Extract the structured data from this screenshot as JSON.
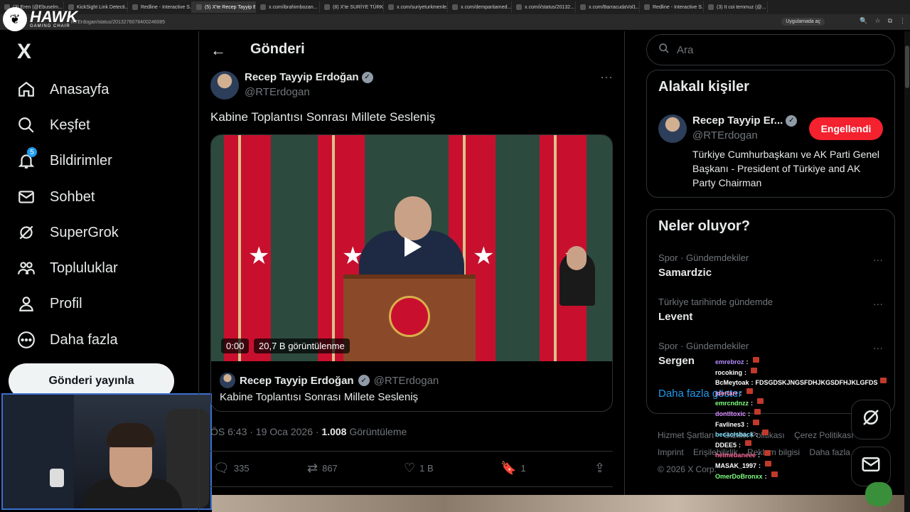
{
  "browser": {
    "tabs": [
      {
        "label": "(3) Eren (@Ebuselm...",
        "active": false
      },
      {
        "label": "KickSight Link Detecti...",
        "active": false
      },
      {
        "label": "Redline - Interactive S...",
        "active": false
      },
      {
        "label": "(5) X'te Recep Tayyip E...",
        "active": true
      },
      {
        "label": "x.com/ibrahimbozan...",
        "active": false
      },
      {
        "label": "(8) X'te SURİYE TÜRKM...",
        "active": false
      },
      {
        "label": "x.com/suriyeturkmenle...",
        "active": false
      },
      {
        "label": "x.com/dempartiamed...",
        "active": false
      },
      {
        "label": "x.com/i/status/20132...",
        "active": false
      },
      {
        "label": "x.com/BarracudaVol1...",
        "active": false
      },
      {
        "label": "Redline - Interactive S...",
        "active": false
      },
      {
        "label": "(3) It coi temmuz (@...",
        "active": false
      }
    ],
    "url": "RTErdogan/status/2013276078400246085",
    "app_pill": "Uygulamada aç"
  },
  "overlay": {
    "brand": "HAWK",
    "brand_sub": "GAMING CHAIR"
  },
  "sidebar": {
    "logo": "X",
    "items": [
      {
        "label": "Anasayfa",
        "icon": "home-icon"
      },
      {
        "label": "Keşfet",
        "icon": "search-icon"
      },
      {
        "label": "Bildirimler",
        "icon": "bell-icon",
        "badge": "5"
      },
      {
        "label": "Sohbet",
        "icon": "mail-icon"
      },
      {
        "label": "SuperGrok",
        "icon": "grok-icon"
      },
      {
        "label": "Topluluklar",
        "icon": "people-icon"
      },
      {
        "label": "Profil",
        "icon": "person-icon"
      },
      {
        "label": "Daha fazla",
        "icon": "more-circle-icon"
      }
    ],
    "post_button": "Gönderi yayınla"
  },
  "main": {
    "header": "Gönderi",
    "tweet": {
      "author_name": "Recep Tayyip Erdoğan",
      "author_handle": "@RTErdogan",
      "text": "Kabine Toplantısı Sonrası Millete Sesleniş",
      "video_time": "0:00",
      "video_views": "20,7 B görüntülenme",
      "quote_name": "Recep Tayyip Erdoğan",
      "quote_handle": "@RTErdogan",
      "quote_text": "Kabine Toplantısı Sonrası Millete Sesleniş",
      "timestamp": "ÖS 6:43 · 19 Oca 2026 ·",
      "views_count": "1.008",
      "views_label": "Görüntüleme",
      "replies": "335",
      "reposts": "867",
      "likes": "1 B",
      "bookmarks": "1"
    }
  },
  "right": {
    "search_placeholder": "Ara",
    "related_title": "Alakalı kişiler",
    "related": {
      "name": "Recep Tayyip Er...",
      "handle": "@RTErdogan",
      "button": "Engellendi",
      "bio": "Türkiye Cumhurbaşkanı ve AK Parti Genel Başkanı - President of Türkiye and AK Party Chairman"
    },
    "trends_title": "Neler oluyor?",
    "trends": [
      {
        "category": "Spor · Gündemdekiler",
        "name": "Samardzic"
      },
      {
        "category": "Türkiye tarihinde gündemde",
        "name": "Levent"
      },
      {
        "category": "Spor · Gündemdekiler",
        "name": "Sergen"
      }
    ],
    "show_more": "Daha fazla göster",
    "footer": [
      "Hizmet Şartları",
      "Gizlilik Politikası",
      "Çerez Politikası",
      "Imprint",
      "Erişilebilirlik",
      "Reklam bilgisi",
      "Daha fazla ...",
      "© 2026 X Corp."
    ]
  },
  "chat": [
    {
      "user": "emrebroz",
      "msg": "",
      "color": "#b38bff"
    },
    {
      "user": "rocoking",
      "msg": "",
      "color": "#ffffff"
    },
    {
      "user": "BcMeytoak",
      "msg": "FDSGDSKJNGSFDHJKGSDFHJKLGFDS",
      "color": "#ffffff"
    },
    {
      "user": "jderfarr",
      "msg": "",
      "color": "#ff9ad5"
    },
    {
      "user": "emrcndnzz",
      "msg": "",
      "color": "#7fff7f"
    },
    {
      "user": "dontltoxic",
      "msg": "",
      "color": "#d88bff"
    },
    {
      "user": "Favlines3",
      "msg": "",
      "color": "#ffffff"
    },
    {
      "user": "becaolsback",
      "msg": "",
      "color": "#7fe0ff"
    },
    {
      "user": "DDEE5",
      "msg": "",
      "color": "#ffffff"
    },
    {
      "user": "heimebaneee",
      "msg": "",
      "color": "#ff6b9a"
    },
    {
      "user": "MASAK_1997",
      "msg": "",
      "color": "#ffffff"
    },
    {
      "user": "OmerDoBronxx",
      "msg": "",
      "color": "#7fff7f"
    }
  ]
}
